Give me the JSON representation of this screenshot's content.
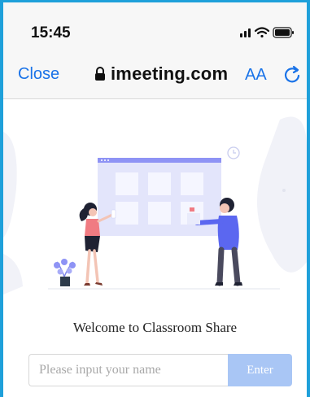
{
  "status_bar": {
    "time": "15:45",
    "icons": [
      "signal-icon",
      "wifi-icon",
      "battery-icon"
    ]
  },
  "browser": {
    "close_label": "Close",
    "url": "imeeting.com",
    "text_size_label": "AA",
    "lock_icon": "lock-icon",
    "reload_icon": "reload-icon",
    "accent_color": "#1a73e8"
  },
  "page": {
    "welcome_text": "Welcome to Classroom Share",
    "name_input": {
      "value": "",
      "placeholder": "Please input your name"
    },
    "enter_label": "Enter",
    "enter_color": "#a9c6f5",
    "illustration_accent": "#8e93f5"
  }
}
